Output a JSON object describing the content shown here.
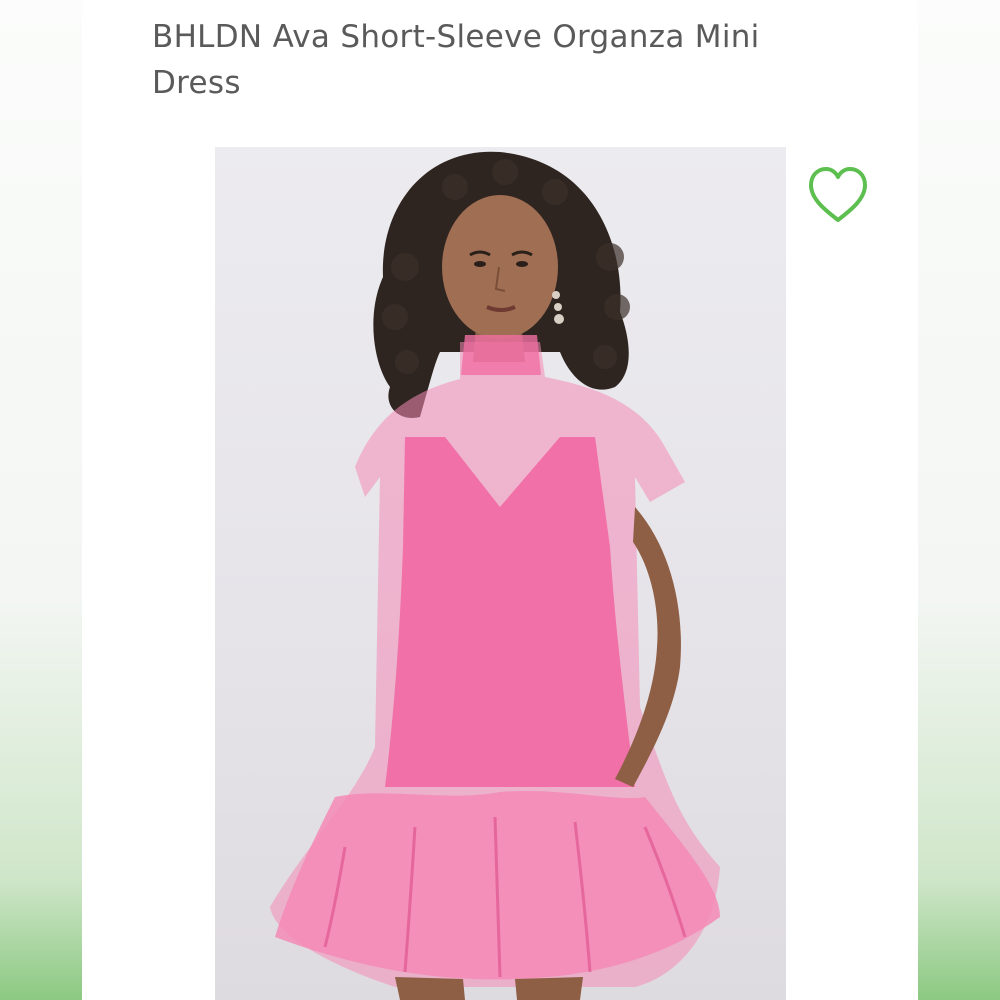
{
  "product": {
    "title": "BHLDN Ava Short-Sleeve Organza Mini Dress"
  },
  "favorite": {
    "icon": "heart-outline-icon",
    "color": "#5cbf4f"
  },
  "theme": {
    "accent": "#5cbf4f",
    "title_color": "#5a5a5a",
    "dress_color": "#f07aa8"
  }
}
